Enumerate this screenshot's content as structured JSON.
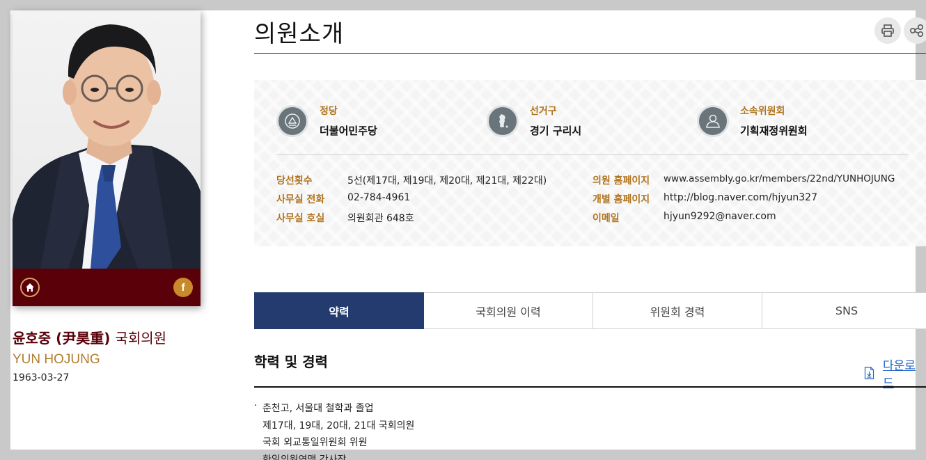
{
  "header": {
    "title": "의원소개"
  },
  "profile": {
    "name_ko": "윤호중 (尹昊重)",
    "role": "국회의원",
    "name_en": "YUN HOJUNG",
    "birth": "1963-03-27",
    "facebook_glyph": "f"
  },
  "facts": [
    {
      "label": "정당",
      "value": "더불어민주당",
      "icon": "party-emblem-icon"
    },
    {
      "label": "선거구",
      "value": "경기 구리시",
      "icon": "korea-map-icon"
    },
    {
      "label": "소속위원회",
      "value": "기획재정위원회",
      "icon": "person-icon"
    }
  ],
  "details_left": [
    {
      "label": "당선횟수",
      "value": "5선(제17대, 제19대, 제20대, 제21대, 제22대)"
    },
    {
      "label": "사무실 전화",
      "value": "02-784-4961"
    },
    {
      "label": "사무실 호실",
      "value": "의원회관 648호"
    }
  ],
  "details_right": [
    {
      "label": "의원 홈페이지",
      "value": "www.assembly.go.kr/members/22nd/YUNHOJUNG"
    },
    {
      "label": "개별 홈페이지",
      "value": "http://blog.naver.com/hjyun327"
    },
    {
      "label": "이메일",
      "value": "hjyun9292@naver.com"
    }
  ],
  "tabs": [
    {
      "label": "약력",
      "active": true
    },
    {
      "label": "국회의원 이력",
      "active": false
    },
    {
      "label": "위원회 경력",
      "active": false
    },
    {
      "label": "SNS",
      "active": false
    }
  ],
  "section": {
    "title": "학력 및 경력",
    "download_label": "다운로드",
    "items": [
      "춘천고, 서울대 철학과 졸업",
      "제17대, 19대, 20대, 21대 국회의원",
      "국회 외교통일위원회 위원",
      "한일의원연맹 간사장"
    ]
  },
  "colors": {
    "brand_dark_red": "#5a0008",
    "accent_gold": "#b0731d",
    "tab_active": "#233b6e",
    "link_blue": "#1e64c8"
  }
}
